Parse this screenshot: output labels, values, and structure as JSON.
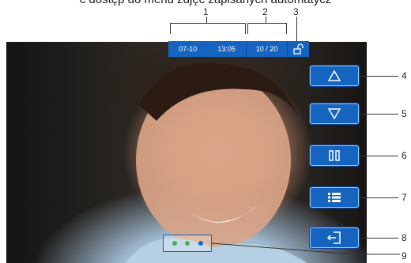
{
  "caption": "ć dostęp do menu zdjęć zapisanych automatycz",
  "status": {
    "date": "07-10",
    "time": "13:05",
    "counter": "10 / 20",
    "lock_icon": "unlock-icon"
  },
  "callouts": [
    "1",
    "2",
    "3",
    "4",
    "5",
    "6",
    "7",
    "8",
    "9"
  ],
  "buttons": [
    {
      "name": "up-button",
      "icon": "triangle-up-icon"
    },
    {
      "name": "down-button",
      "icon": "triangle-down-icon"
    },
    {
      "name": "pause-button",
      "icon": "pause-icon"
    },
    {
      "name": "menu-button",
      "icon": "list-icon"
    },
    {
      "name": "exit-button",
      "icon": "exit-icon"
    }
  ],
  "dots": {
    "colors": [
      "#4caf50",
      "#4caf50",
      "#1565c0"
    ]
  },
  "colors": {
    "accent": "#1565c0",
    "accent_dark": "#0d47a1"
  }
}
